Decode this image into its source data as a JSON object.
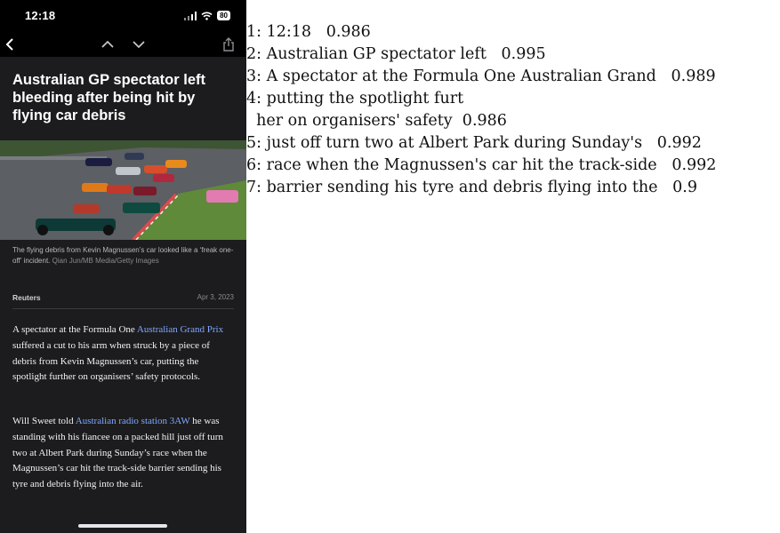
{
  "status_bar": {
    "time": "12:18",
    "battery": "80"
  },
  "nav": {
    "back_icon": "chevron-left-icon",
    "prev_icon": "chevron-up-icon",
    "next_icon": "chevron-down-icon",
    "share_icon": "share-icon"
  },
  "article": {
    "headline": "Australian GP spectator left bleeding after being hit by flying car debris",
    "caption_text": "The flying debris from Kevin Magnussen’s car looked like a ‘freak one-off’ incident.",
    "caption_credit": "Qian Jun/MB Media/Getty Images",
    "source": "Reuters",
    "date": "Apr 3, 2023",
    "p1_pre": "A spectator at the Formula One ",
    "p1_link": "Australian Grand Prix",
    "p1_post": " suffered a cut to his arm when struck by a piece of debris from Kevin Magnussen’s car, putting the spotlight further on organisers’ safety protocols.",
    "p2_pre": "Will Sweet told ",
    "p2_link": "Australian radio station 3AW",
    "p2_post": " he was standing with his fiancee on a packed hill just off turn two at Albert Park during Sunday’s race when the Magnussen’s car hit the track-side barrier sending his tyre and debris flying into the air."
  },
  "ocr_results": [
    "1: 12:18   0.986",
    "2: Australian GP spectator left   0.995",
    "3: A spectator at the Formula One Australian Grand   0.989",
    "4: putting the spotlight furt",
    "  her on organisers' safety  0.986",
    "5: just off turn two at Albert Park during Sunday's   0.992",
    "6: race when the Magnussen's car hit the track-side   0.992",
    "7: barrier sending his tyre and debris flying into the   0.9"
  ],
  "colors": {
    "background": "#1c1c1e",
    "link": "#7fa7ff",
    "highlight_box": "#e02020"
  }
}
